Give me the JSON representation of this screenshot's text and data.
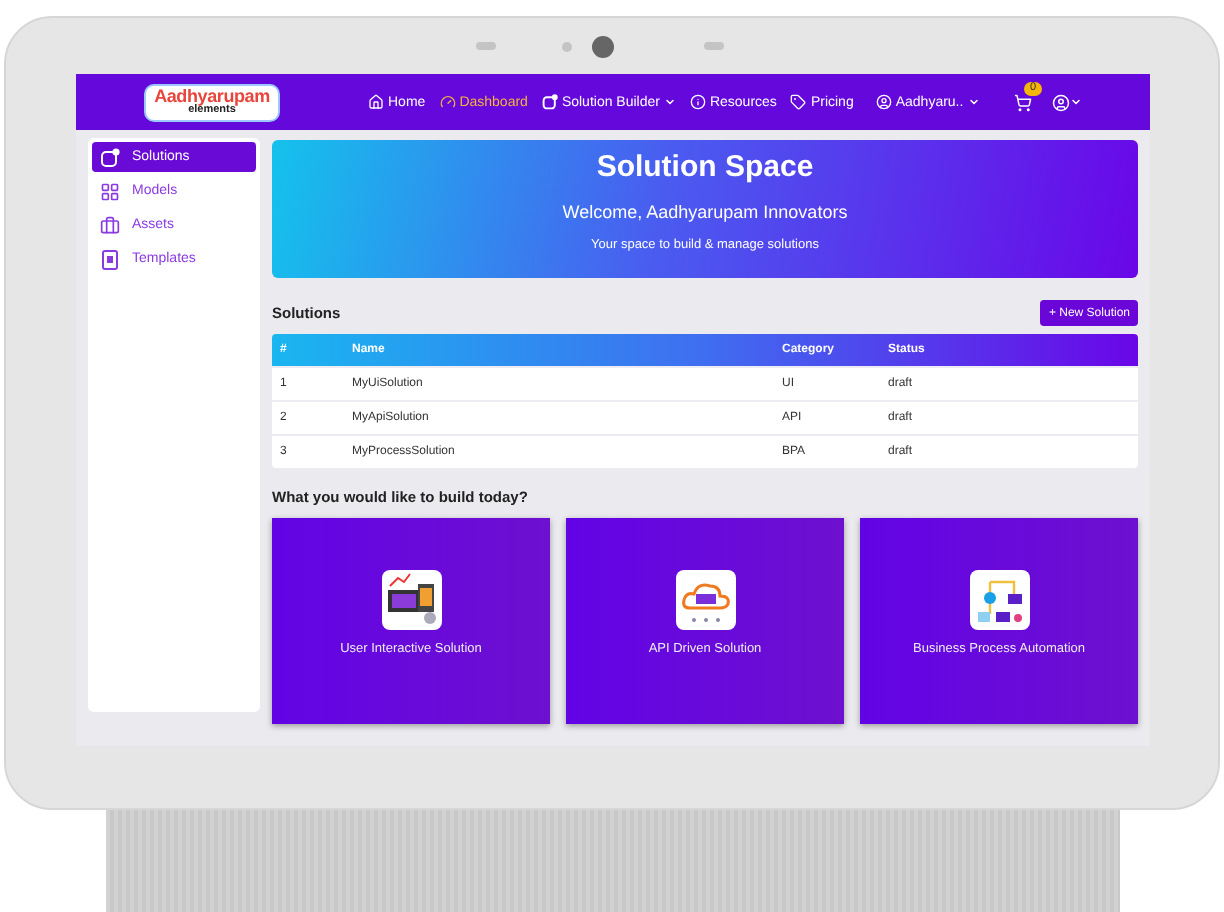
{
  "navbar": {
    "logo": {
      "title": "Aadhyarupam",
      "subtitle": "elements"
    },
    "items": [
      {
        "label": "Home",
        "selected": false,
        "dropdown": false
      },
      {
        "label": "Dashboard",
        "selected": true,
        "dropdown": false
      },
      {
        "label": "Solution Builder",
        "selected": false,
        "dropdown": true
      },
      {
        "label": "Resources",
        "selected": false,
        "dropdown": false
      },
      {
        "label": "Pricing",
        "selected": false,
        "dropdown": false
      }
    ],
    "user": "Aadhyaru..",
    "cart_count": "0"
  },
  "sidebar": {
    "items": [
      {
        "label": "Solutions",
        "selected": true
      },
      {
        "label": "Models",
        "selected": false
      },
      {
        "label": "Assets",
        "selected": false
      },
      {
        "label": "Templates",
        "selected": false
      }
    ]
  },
  "hero": {
    "title": "Solution Space",
    "welcome": "Welcome, Aadhyarupam Innovators",
    "subtitle": "Your space to build & manage solutions"
  },
  "solutions": {
    "heading": "Solutions",
    "new_button": "+ New Solution",
    "columns": [
      "#",
      "Name",
      "Category",
      "Status"
    ],
    "rows": [
      [
        "1",
        "MyUiSolution",
        "UI",
        "draft"
      ],
      [
        "2",
        "MyApiSolution",
        "API",
        "draft"
      ],
      [
        "3",
        "MyProcessSolution",
        "BPA",
        "draft"
      ]
    ]
  },
  "build": {
    "heading": "What you would like to build today?",
    "cards": [
      {
        "label": "User Interactive Solution"
      },
      {
        "label": "API Driven Solution"
      },
      {
        "label": "Business Process Automation"
      }
    ]
  }
}
